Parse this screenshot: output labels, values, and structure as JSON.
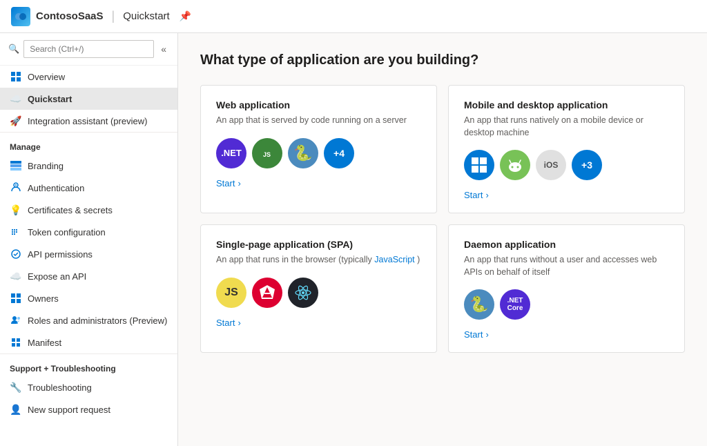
{
  "topbar": {
    "app_name": "ContosoSaaS",
    "separator": "|",
    "page_name": "Quickstart",
    "pin_icon": "📌"
  },
  "sidebar": {
    "search_placeholder": "Search (Ctrl+/)",
    "overview_label": "Overview",
    "quickstart_label": "Quickstart",
    "integration_label": "Integration assistant (preview)",
    "manage_header": "Manage",
    "branding_label": "Branding",
    "authentication_label": "Authentication",
    "certificates_label": "Certificates & secrets",
    "token_label": "Token configuration",
    "api_permissions_label": "API permissions",
    "expose_api_label": "Expose an API",
    "owners_label": "Owners",
    "roles_label": "Roles and administrators (Preview)",
    "manifest_label": "Manifest",
    "support_header": "Support + Troubleshooting",
    "troubleshooting_label": "Troubleshooting",
    "support_request_label": "New support request"
  },
  "main": {
    "question": "What type of application are you building?",
    "cards": [
      {
        "id": "web-app",
        "title": "Web application",
        "desc": "An app that is served by code running on a server",
        "start_label": "Start",
        "icons": [
          {
            "label": ".NET",
            "class": "icon-dotnet",
            "display": ".NET"
          },
          {
            "label": "Node.js",
            "class": "icon-node",
            "display": "⬡"
          },
          {
            "label": "Python",
            "class": "icon-python",
            "display": "🐍"
          },
          {
            "label": "+4",
            "class": "icon-plus4",
            "display": "+4"
          }
        ]
      },
      {
        "id": "mobile-desktop",
        "title": "Mobile and desktop application",
        "desc": "An app that runs natively on a mobile device or desktop machine",
        "start_label": "Start",
        "icons": [
          {
            "label": "Windows",
            "class": "icon-windows",
            "display": "⊞"
          },
          {
            "label": "Android",
            "class": "icon-android",
            "display": "🤖"
          },
          {
            "label": "iOS",
            "class": "icon-ios",
            "display": "iOS"
          },
          {
            "label": "+3",
            "class": "icon-plus3",
            "display": "+3"
          }
        ]
      },
      {
        "id": "spa",
        "title": "Single-page application (SPA)",
        "desc_part1": "An app that runs in the browser (typically",
        "desc_link": "JavaScript",
        "desc_part2": ")",
        "start_label": "Start",
        "icons": [
          {
            "label": "JavaScript",
            "class": "icon-js",
            "display": "JS"
          },
          {
            "label": "Angular",
            "class": "icon-angular",
            "display": "▲"
          },
          {
            "label": "React",
            "class": "icon-react",
            "display": "⚛"
          }
        ]
      },
      {
        "id": "daemon",
        "title": "Daemon application",
        "desc": "An app that runs without a user and accesses web APIs on behalf of itself",
        "start_label": "Start",
        "icons": [
          {
            "label": "Python",
            "class": "icon-python2",
            "display": "🐍"
          },
          {
            "label": ".NET Core",
            "class": "icon-netcore",
            "display": ".NET Core"
          }
        ]
      }
    ]
  }
}
